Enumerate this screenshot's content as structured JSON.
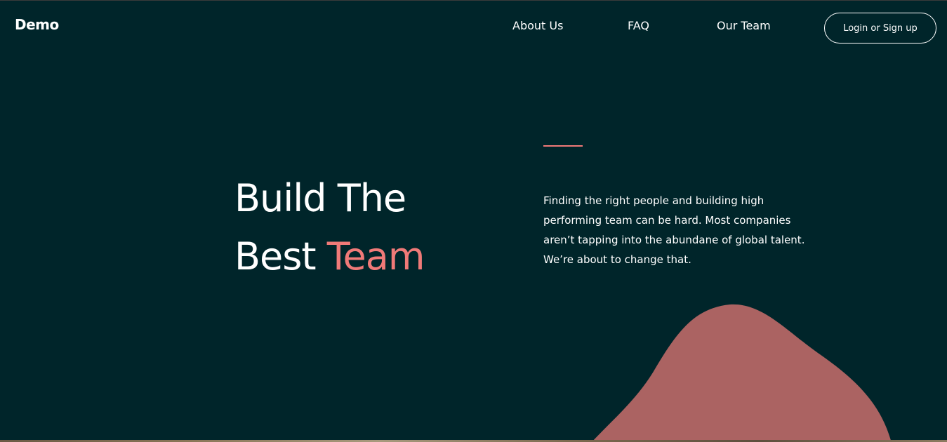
{
  "header": {
    "logo": "Demo",
    "nav": {
      "about": "About Us",
      "faq": "FAQ",
      "team": "Our Team"
    },
    "login_label": "Login or Sign up"
  },
  "hero": {
    "title_line1": "Build The",
    "title_line2_plain": "Best",
    "title_line2_accent": "Team",
    "description": "Finding the right people and building high performing team can be hard. Most companies aren’t tapping into the abundane of global talent. We’re about to change that."
  },
  "colors": {
    "background": "#00252a",
    "accent": "#f07a78",
    "blob": "#ab6362",
    "text": "#ffffff"
  }
}
